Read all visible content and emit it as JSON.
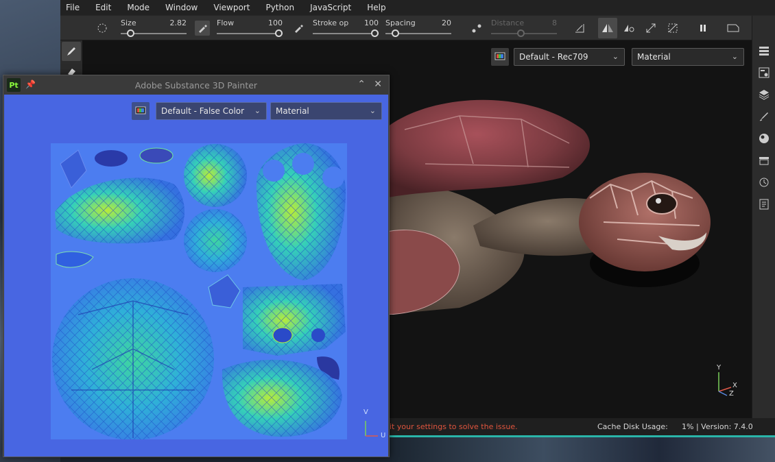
{
  "menu": [
    "File",
    "Edit",
    "Mode",
    "Window",
    "Viewport",
    "Python",
    "JavaScript",
    "Help"
  ],
  "toolbar": {
    "size": {
      "label": "Size",
      "value": "2.82",
      "level": 0.1
    },
    "flow": {
      "label": "Flow",
      "value": "100",
      "level": 1.0
    },
    "stroke_opacity": {
      "label": "Stroke op",
      "value": "100",
      "level": 1.0
    },
    "spacing": {
      "label": "Spacing",
      "value": "20",
      "level": 0.1
    },
    "distance": {
      "label": "Distance",
      "value": "8",
      "level": 0.45,
      "disabled": true
    }
  },
  "viewport": {
    "display_preset": "Default - Rec709",
    "channel": "Material"
  },
  "right_rail_icons": [
    "texture-set-list-icon",
    "texture-set-settings-icon",
    "layers-icon",
    "properties-icon",
    "display-settings-icon",
    "shelf-icon",
    "history-icon",
    "log-icon"
  ],
  "status": {
    "warning": "it your settings to solve the issue.",
    "cache_label": "Cache Disk Usage:",
    "cache_value": "1% | Version: 7.4.0"
  },
  "float_window": {
    "title": "Adobe Substance 3D Painter",
    "logo": "Pt",
    "display_preset": "Default - False Color",
    "channel": "Material",
    "axis_v": "V",
    "axis_u": "U"
  },
  "gizmo": {
    "y": "Y",
    "x": "X",
    "z": "Z"
  },
  "colors": {
    "accent": "#2ab5a9",
    "warning": "#e0553e",
    "uv_bg": "#4866e2"
  }
}
